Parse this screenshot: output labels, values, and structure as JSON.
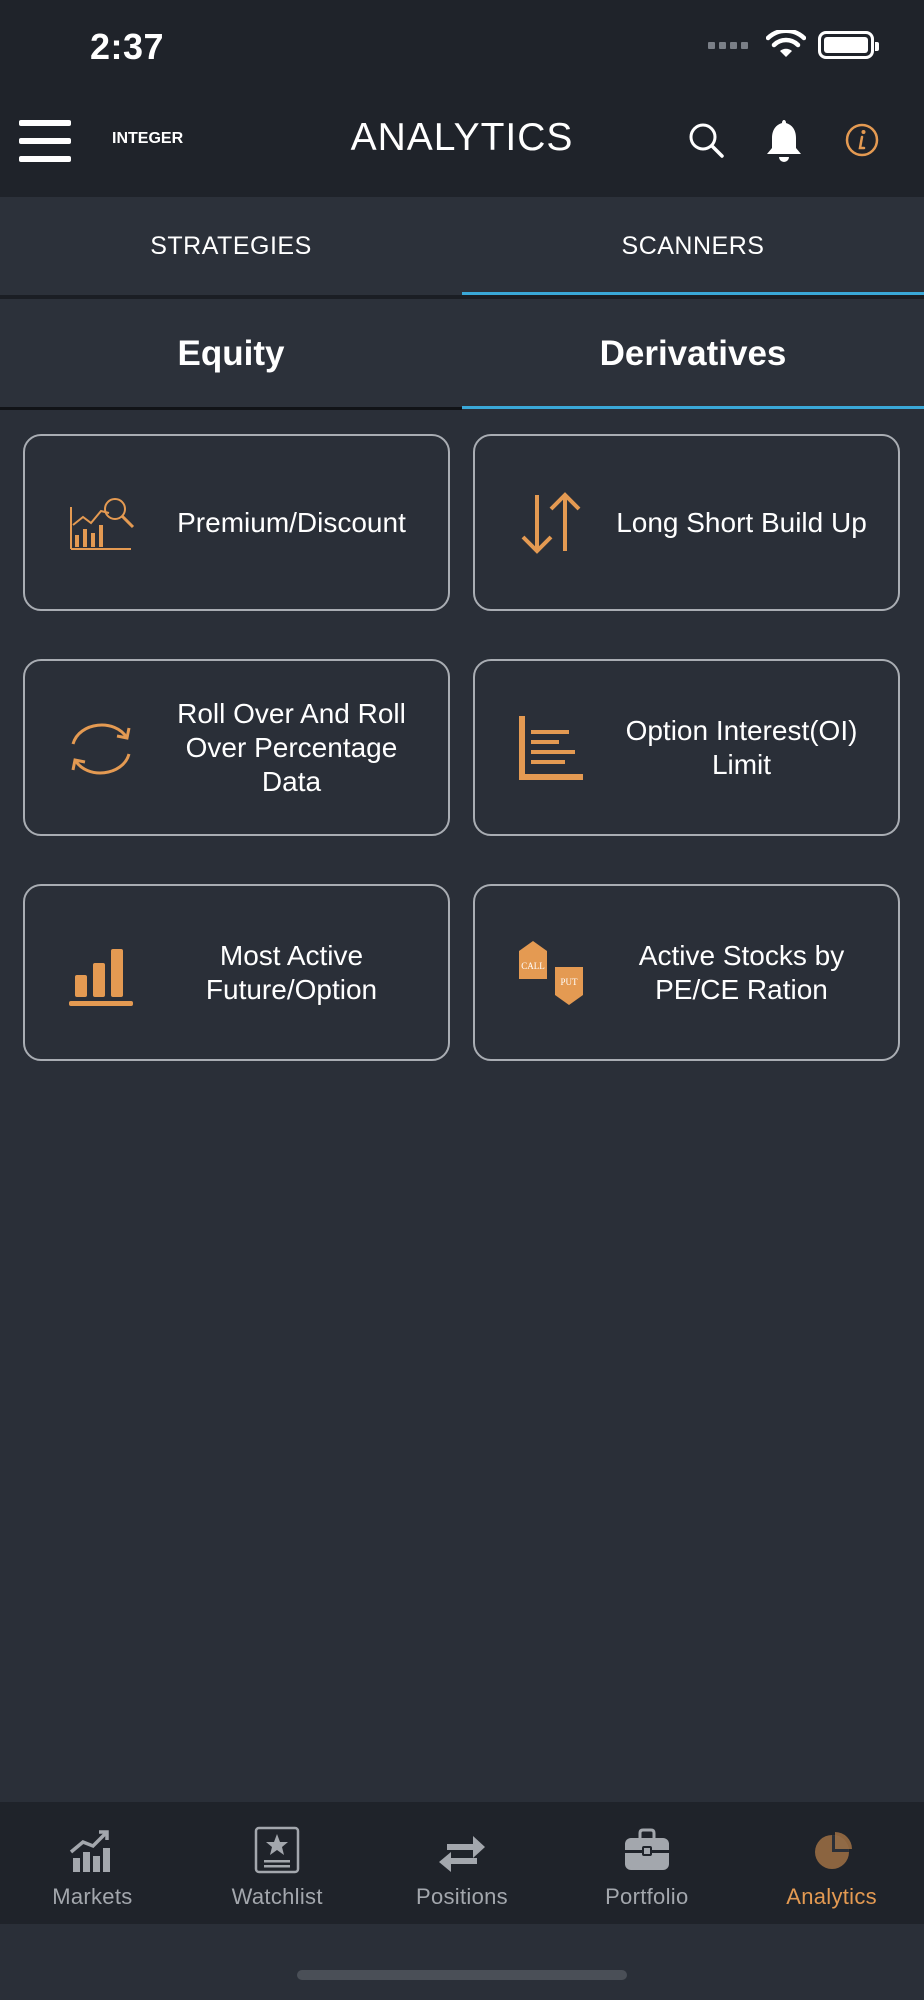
{
  "status": {
    "time": "2:37"
  },
  "header": {
    "logo": "INTEGER",
    "title": "ANALYTICS"
  },
  "main_tabs": [
    {
      "label": "STRATEGIES"
    },
    {
      "label": "SCANNERS",
      "active": true
    }
  ],
  "sub_tabs": [
    {
      "label": "Equity"
    },
    {
      "label": "Derivatives",
      "active": true
    }
  ],
  "cards": [
    {
      "label": "Premium/Discount",
      "icon": "chart-magnifier-icon"
    },
    {
      "label": "Long Short Build Up",
      "icon": "up-down-arrows-icon"
    },
    {
      "label": "Roll Over And Roll Over Percentage Data",
      "icon": "rollover-cycle-icon"
    },
    {
      "label": "Option Interest(OI) Limit",
      "icon": "horizontal-bars-icon"
    },
    {
      "label": "Most Active Future/Option",
      "icon": "bar-chart-icon"
    },
    {
      "label": "Active Stocks by PE/CE Ration",
      "icon": "call-put-icon",
      "badge_top": "CALL",
      "badge_bottom": "PUT"
    }
  ],
  "bottom_nav": [
    {
      "label": "Markets",
      "icon": "markets-icon"
    },
    {
      "label": "Watchlist",
      "icon": "watchlist-icon"
    },
    {
      "label": "Positions",
      "icon": "positions-icon"
    },
    {
      "label": "Portfolio",
      "icon": "portfolio-icon"
    },
    {
      "label": "Analytics",
      "icon": "analytics-icon",
      "active": true
    }
  ],
  "colors": {
    "accent": "#e49a52",
    "tab_indicator": "#3aa8d8",
    "background": "#2a2f38",
    "header": "#1f232a"
  }
}
